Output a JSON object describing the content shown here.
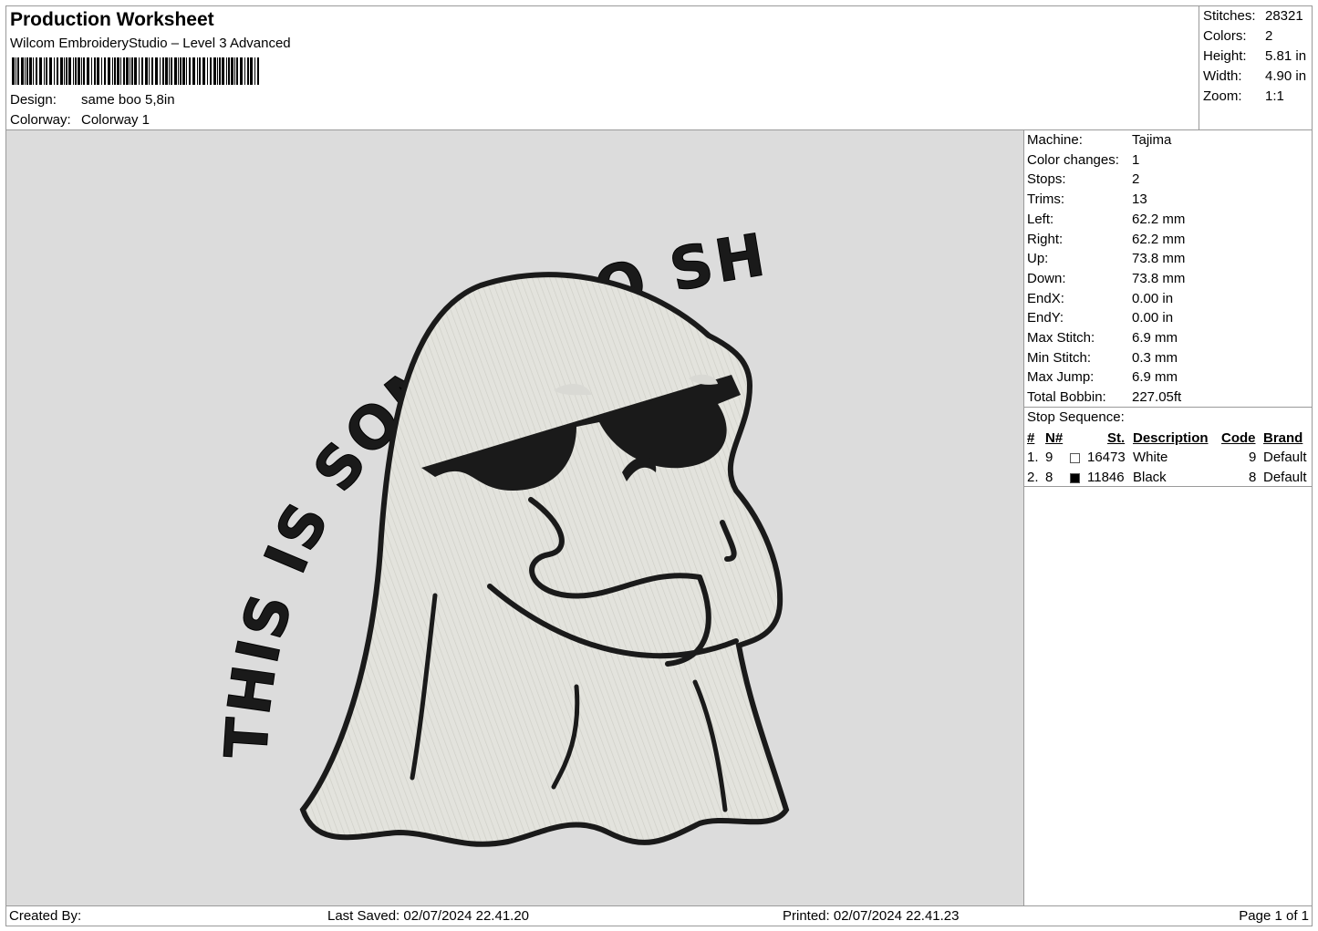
{
  "header": {
    "title": "Production Worksheet",
    "software": "Wilcom EmbroideryStudio – Level 3 Advanced",
    "design_label": "Design:",
    "design_value": "same boo 5,8in",
    "colorway_label": "Colorway:",
    "colorway_value": "Colorway 1"
  },
  "summary": [
    {
      "label": "Stitches:",
      "value": "28321"
    },
    {
      "label": "Colors:",
      "value": "2"
    },
    {
      "label": "Height:",
      "value": "5.81 in"
    },
    {
      "label": "Width:",
      "value": "4.90 in"
    },
    {
      "label": "Zoom:",
      "value": "1:1"
    }
  ],
  "stats": [
    {
      "label": "Machine:",
      "value": "Tajima"
    },
    {
      "label": "Color changes:",
      "value": "1"
    },
    {
      "label": "Stops:",
      "value": "2"
    },
    {
      "label": "Trims:",
      "value": "13"
    },
    {
      "label": "Left:",
      "value": "62.2 mm"
    },
    {
      "label": "Right:",
      "value": "62.2 mm"
    },
    {
      "label": "Up:",
      "value": "73.8 mm"
    },
    {
      "label": "Down:",
      "value": "73.8 mm"
    },
    {
      "label": "EndX:",
      "value": "0.00 in"
    },
    {
      "label": "EndY:",
      "value": "0.00 in"
    },
    {
      "label": "Max Stitch:",
      "value": "6.9 mm"
    },
    {
      "label": "Min Stitch:",
      "value": "0.3 mm"
    },
    {
      "label": "Max Jump:",
      "value": "6.9 mm"
    },
    {
      "label": "Total Bobbin:",
      "value": "227.05ft"
    }
  ],
  "stop_sequence": {
    "title": "Stop Sequence:",
    "headers": {
      "index": "#",
      "n": "N#",
      "st": "St.",
      "description": "Description",
      "code": "Code",
      "brand": "Brand"
    },
    "rows": [
      {
        "index": "1.",
        "n": "9",
        "color": "#ffffff",
        "st": "16473",
        "description": "White",
        "code": "9",
        "brand": "Default"
      },
      {
        "index": "2.",
        "n": "8",
        "color": "#000000",
        "st": "11846",
        "description": "Black",
        "code": "8",
        "brand": "Default"
      }
    ]
  },
  "design_art": {
    "text": "THIS IS SOME BOO SHEET",
    "fill_color": "#e2e2dd",
    "outline_color": "#1a1a1a",
    "background_color": "#dcdcdc"
  },
  "footer": {
    "created_by": "Created By:",
    "last_saved": "Last Saved: 02/07/2024 22.41.20",
    "printed": "Printed: 02/07/2024 22.41.23",
    "page": "Page 1 of 1"
  }
}
